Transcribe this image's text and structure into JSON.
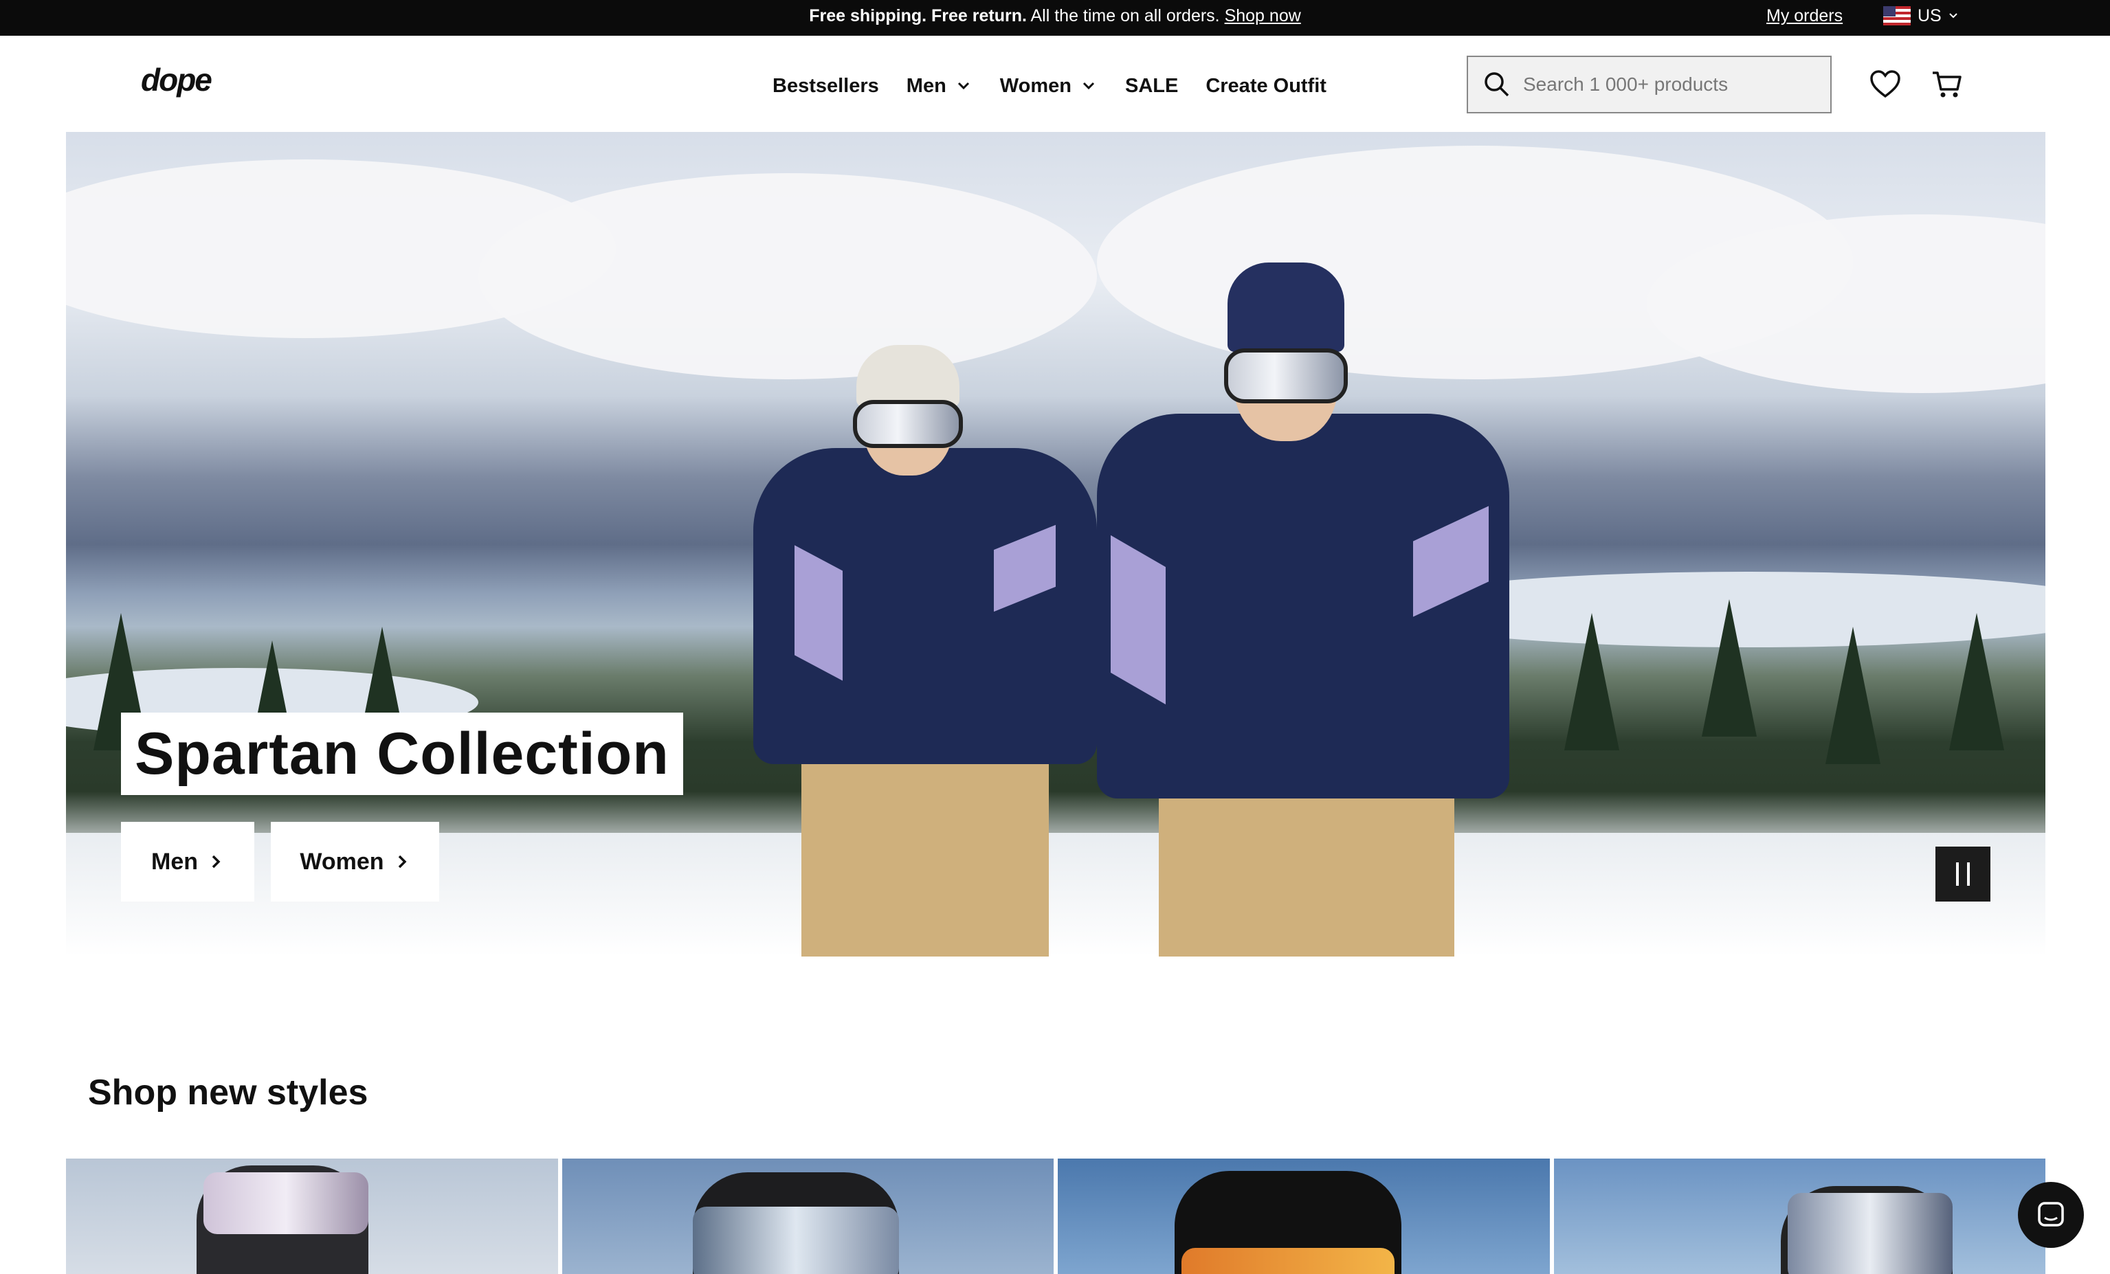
{
  "announcement": {
    "bold_text": "Free shipping. Free return.",
    "text": " All the time on all orders. ",
    "link": "Shop now",
    "orders_link": "My orders",
    "region": "US"
  },
  "header": {
    "logo": "dope",
    "nav": [
      {
        "label": "Bestsellers",
        "has_dropdown": false
      },
      {
        "label": "Men",
        "has_dropdown": true
      },
      {
        "label": "Women",
        "has_dropdown": true
      },
      {
        "label": "SALE",
        "has_dropdown": false
      },
      {
        "label": "Create Outfit",
        "has_dropdown": false
      }
    ],
    "search_placeholder": "Search 1 000+ products",
    "icons": [
      "search-icon",
      "heart-icon",
      "cart-icon"
    ]
  },
  "hero": {
    "title": "Spartan Collection",
    "buttons": [
      {
        "label": "Men"
      },
      {
        "label": "Women"
      }
    ],
    "controls": [
      "pause-icon"
    ]
  },
  "section": {
    "title": "Shop new styles"
  },
  "colors": {
    "announcement_bg": "#0b0b0b",
    "jacket": "#1e2a55",
    "jacket_accent": "#a9a0d6",
    "pants": "#cfb07c"
  }
}
